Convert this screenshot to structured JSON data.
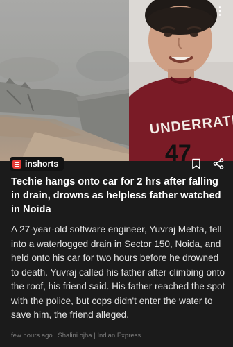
{
  "card": {
    "more_icon": "more-vertical-icon"
  },
  "source": {
    "brand": "inshorts",
    "brand_color": "#e53935",
    "bookmark_icon": "bookmark-icon",
    "share_icon": "share-icon"
  },
  "article": {
    "headline": "Techie hangs onto car for 2 hrs after falling in drain, drowns as helpless father watched in Noida",
    "body": "A 27-year-old software engineer, Yuvraj Mehta, fell into a waterlogged drain in Sector 150, Noida, and held onto his car for two hours before he drowned to death. Yuvraj called his father after climbing onto the roof, his friend said. His father reached the spot with the police, but cops didn't enter the water to save him, the friend alleged.",
    "time": "few hours ago",
    "author": "Shalini ojha",
    "publisher": "Indian Express"
  },
  "image": {
    "shirt_text": "UNDERRATED"
  }
}
